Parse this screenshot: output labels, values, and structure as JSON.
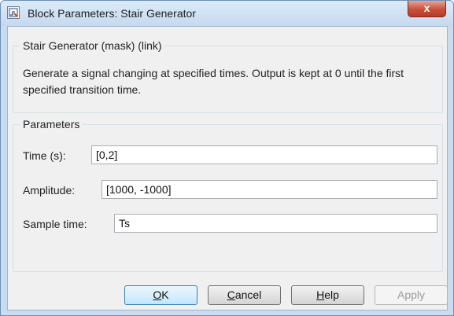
{
  "window": {
    "title": "Block Parameters: Stair Generator",
    "close_glyph": "x"
  },
  "mask_group": {
    "label": "Stair Generator (mask) (link)",
    "description": "Generate a signal changing at specified times. Output is kept at 0 until the first specified transition time."
  },
  "parameters": {
    "label": "Parameters",
    "fields": [
      {
        "label": "Time (s):",
        "value": "[0,2]"
      },
      {
        "label": "Amplitude:",
        "value": "[1000, -1000]"
      },
      {
        "label": "Sample time:",
        "value": "Ts"
      }
    ]
  },
  "buttons": {
    "ok_u": "O",
    "ok_rest": "K",
    "cancel_u": "C",
    "cancel_rest": "ancel",
    "help_u": "H",
    "help_rest": "elp",
    "apply": "Apply"
  },
  "colors": {
    "title_bar": "#c5d9ee",
    "close_button": "#c8503a",
    "client_background": "#f0f0f0",
    "default_button": "#bee6fd"
  }
}
